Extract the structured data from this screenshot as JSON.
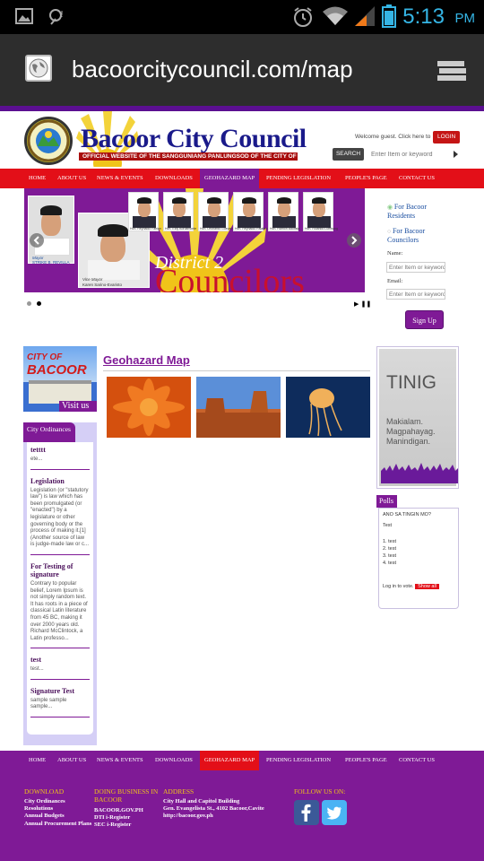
{
  "status_bar": {
    "time": "5:13",
    "ampm": "PM"
  },
  "browser": {
    "url": "bacoorcitycouncil.com/map"
  },
  "header": {
    "site_title": "Bacoor City Council",
    "subtitle": "OFFICIAL WEBSITE OF THE SANGGUNIANG PANLUNGSOD OF THE CITY OF BACOOR, CAVITE",
    "welcome": "Welcome guest. Click here to",
    "login_label": "LOGIN",
    "search_label": "SEARCH",
    "search_placeholder": "Enter Item or keyword"
  },
  "nav": {
    "items": [
      "HOME",
      "ABOUT US",
      "NEWS & EVENTS",
      "DOWNLOADS",
      "GEOHAZARD MAP",
      "PENDING LEGISLATION",
      "PEOPLE'S PAGE",
      "CONTACT US"
    ],
    "active_index": 4
  },
  "slider": {
    "district": "District 2",
    "councilors": "Councilors",
    "mayor_caption": "Mayor",
    "mayor_name": "STRIKE B. REVILLA",
    "vice_caption": "Vice Mayor",
    "vice_name": "Karen Sarino-Evaristo",
    "councilor_names": [
      "Hon. Reynaldo Fabian",
      "Hon. Eloy Bordamonte",
      "Hon. Leonardo Guevarra",
      "Hon. Reynaldo Palabrica",
      "Hon. Ramon Bautista",
      "Hon. Rolando Lumbang"
    ],
    "slide_count": 2,
    "active_slide": 2
  },
  "sidebar": {
    "links": [
      "For Bacoor Residents",
      "For Bacoor Councilors"
    ],
    "name_label": "Name:",
    "name_placeholder": "Enter Item or keyword",
    "email_label": "Email:",
    "email_placeholder": "Enter Item or keyword",
    "signup_label": "Sign Up"
  },
  "city_banner": {
    "title_line1": "CITY OF",
    "title_line2": "BACOOR",
    "visit": "Visit us"
  },
  "ordinances": {
    "tab_label": "City Ordinances",
    "items": [
      {
        "title": "tetttt",
        "text": "ete..."
      },
      {
        "title": "Legislation",
        "text": "Legislation (or \"statutory law\") is law which has been promulgated (or \"enacted\") by a legislature or other governing body or the process of making it.[1] (Another source of law is judge-made law or c..."
      },
      {
        "title": "For Testing of signature",
        "text": "Contrary to popular belief, Lorem Ipsum is not simply random text. It has roots in a piece of classical Latin literature from 45 BC, making it over 2000 years old. Richard McClintock, a Latin professo..."
      },
      {
        "title": "test",
        "text": "test..."
      },
      {
        "title": "Signature Test",
        "text": "sample sample sample..."
      }
    ]
  },
  "geohazard": {
    "title": "Geohazard Map",
    "images": [
      "chrysanthemum-image",
      "desert-image",
      "jellyfish-image"
    ]
  },
  "tinig": {
    "word": "TINIG",
    "slogan_lines": [
      "Makialam.",
      "Magpahayag.",
      "Manindigan."
    ]
  },
  "polls": {
    "tab_label": "Polls",
    "question": "ANO SA TINGIN MO?",
    "title": "Test",
    "options": [
      "1. test",
      "2. test",
      "3. test",
      "4. test"
    ],
    "footer": "Log in to vote.",
    "show_all": "Show all"
  },
  "footer": {
    "download": {
      "heading": "DOWNLOAD",
      "items": [
        "City Ordinances",
        "Resolutions",
        "Annual Budgets",
        "Annual Procurement Plans"
      ]
    },
    "business": {
      "heading": "DOING BUSINESS IN BACOOR",
      "items": [
        "BACOOR.GOV.PH",
        "DTI i-Register",
        "SEC i-Register"
      ]
    },
    "address": {
      "heading": "ADDRESS",
      "items": [
        "City Hall and Capitol Building",
        "Gen. Evangelista St., 4102 Bacoor,Cavite",
        "http://bacoor.gov.ph"
      ]
    },
    "follow": {
      "heading": "FOLLOW US ON:"
    }
  },
  "colors": {
    "purple": "#7f1a96",
    "red": "#e30f18",
    "gold": "#f0c419",
    "facebook": "#3b5998",
    "twitter": "#4ab3f4"
  }
}
